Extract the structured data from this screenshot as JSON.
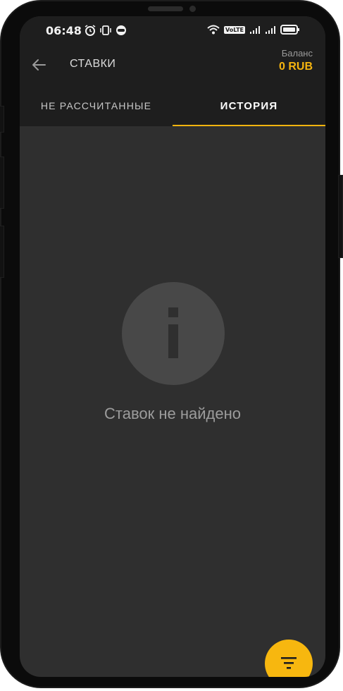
{
  "status_bar": {
    "time": "06:48",
    "left_icons": [
      "alarm-icon",
      "vibrate-icon",
      "app-notification-icon"
    ],
    "right_icons": [
      "wifi-icon",
      "volte-icon",
      "signal-icon",
      "signal-icon",
      "battery-icon"
    ],
    "volte_label": "VoLTE"
  },
  "appbar": {
    "title": "СТАВКИ",
    "balance_label": "Баланс",
    "balance_value": "0 RUB"
  },
  "tabs": [
    {
      "label": "НЕ РАССЧИТАННЫЕ",
      "active": false
    },
    {
      "label": "ИСТОРИЯ",
      "active": true
    }
  ],
  "empty_state": {
    "icon": "info-icon",
    "message": "Ставок не найдено"
  },
  "fab": {
    "icon": "filter-icon"
  },
  "colors": {
    "accent": "#f5b40f",
    "background": "#2f2f2f",
    "header": "#1e1e1e"
  }
}
